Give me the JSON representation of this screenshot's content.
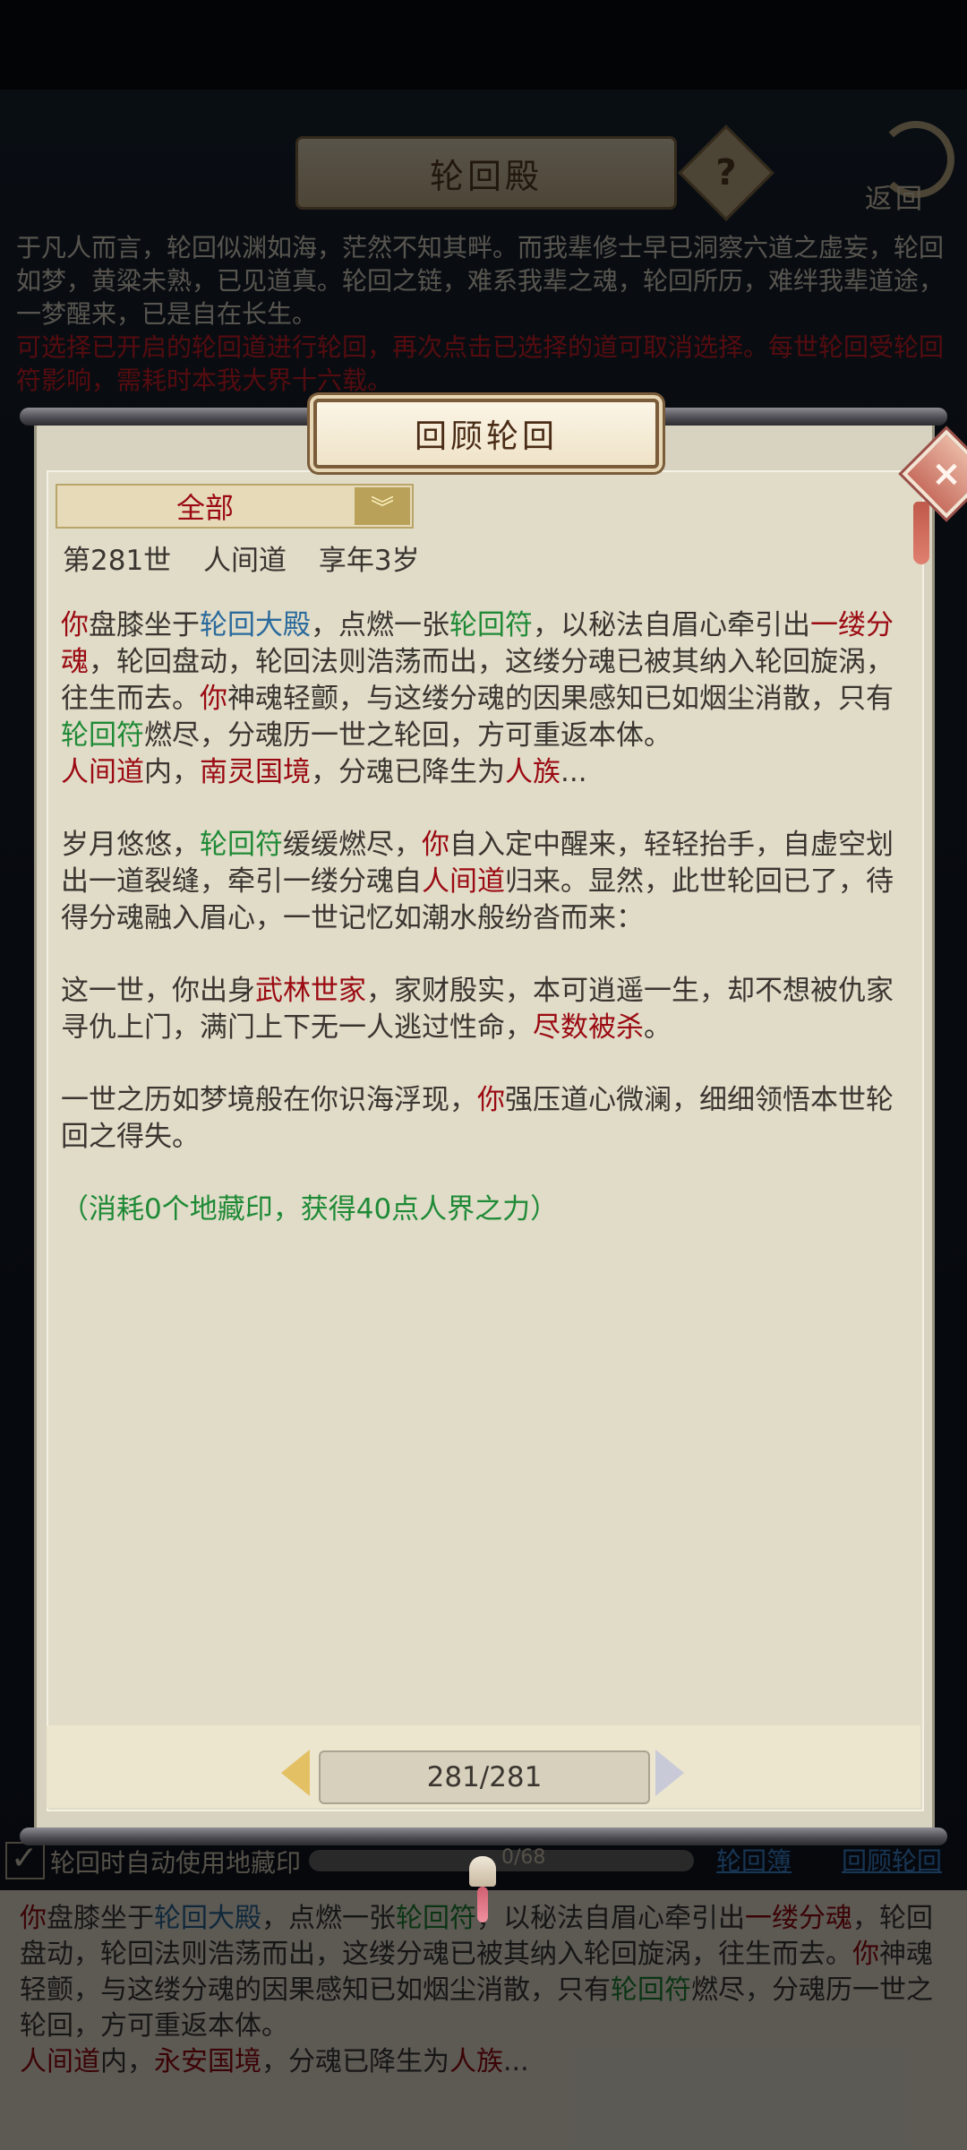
{
  "background": {
    "title": "轮回殿",
    "help_icon": "?",
    "back_label": "返回",
    "intro_text": "于凡人而言，轮回似渊如海，茫然不知其畔。而我辈修士早已洞察六道之虚妄，轮回如梦，黄粱未熟，已见道真。轮回之链，难系我辈之魂，轮回所历，难绊我辈道途，一梦醒来，已是自在长生。",
    "intro_warning": "可选择已开启的轮回道进行轮回，再次点击已选择的道可取消选择。每世轮回受轮回符影响，需耗时本我大界十六载。",
    "auto_use_label": "轮回时自动使用地藏印",
    "progress_text": "0/68",
    "link_book": "轮回簿",
    "link_review": "回顾轮回",
    "log": {
      "p1_you": "你",
      "p1_a": "盘膝坐于",
      "p1_hall": "轮回大殿",
      "p1_b": "，点燃一张",
      "p1_talisman": "轮回符",
      "p1_c": "，以秘法自眉心牵引出",
      "p1_soul": "一缕分魂",
      "p1_d": "，轮回盘动，轮回法则浩荡而出，这缕分魂已被其纳入轮回旋涡，往生而去。",
      "p1_you2": "你",
      "p1_e": "神魂轻颤，与这缕分魂的因果感知已如烟尘消散，只有",
      "p1_talisman2": "轮回符",
      "p1_f": "燃尽，分魂历一世之轮回，方可重返本体。",
      "p2_path": "人间道",
      "p2_a": "内，",
      "p2_realm": "永安国境",
      "p2_b": "，分魂已降生为",
      "p2_race": "人族",
      "p2_c": "..."
    }
  },
  "modal": {
    "title": "回顾轮回",
    "close_icon": "×",
    "filter": {
      "selected": "全部",
      "arrow_icon": "chevron-down-icon"
    },
    "record_header": {
      "life": "第281世",
      "path": "人间道",
      "age": "享年3岁"
    },
    "story": {
      "p1_you": "你",
      "p1_a": "盘膝坐于",
      "p1_hall": "轮回大殿",
      "p1_b": "，点燃一张",
      "p1_talisman": "轮回符",
      "p1_c": "，以秘法自眉心牵引出",
      "p1_soul": "一缕分魂",
      "p1_d": "，轮回盘动，轮回法则浩荡而出，这缕分魂已被其纳入轮回旋涡，往生而去。",
      "p1_you2": "你",
      "p1_e": "神魂轻颤，与这缕分魂的因果感知已如烟尘消散，只有",
      "p1_talisman2": "轮回符",
      "p1_f": "燃尽，分魂历一世之轮回，方可重返本体。",
      "p2_path": "人间道",
      "p2_a": "内，",
      "p2_realm": "南灵国境",
      "p2_b": "，分魂已降生为",
      "p2_race": "人族",
      "p2_c": "...",
      "p3_a": "岁月悠悠，",
      "p3_talisman": "轮回符",
      "p3_b": "缓缓燃尽，",
      "p3_you": "你",
      "p3_c": "自入定中醒来，轻轻抬手，自虚空划出一道裂缝，牵引一缕分魂自",
      "p3_path": "人间道",
      "p3_d": "归来。显然，此世轮回已了，待得分魂融入眉心，一世记忆如潮水般纷沓而来：",
      "p4_a": "这一世，你出身",
      "p4_family": "武林世家",
      "p4_b": "，家财殷实，本可逍遥一生，却不想被仇家寻仇上门，满门上下无一人逃过性命，",
      "p4_fate": "尽数被杀",
      "p4_c": "。",
      "p5_a": "一世之历如梦境般在你识海浮现，",
      "p5_you": "你",
      "p5_b": "强压道心微澜，细细领悟本世轮回之得失。",
      "p6": "（消耗0个地藏印，获得40点人界之力）"
    },
    "pager": {
      "current": "281/281"
    }
  },
  "colors": {
    "highlight_red": "#9b0a12",
    "highlight_green": "#1f8a36",
    "highlight_blue": "#2a6a9c",
    "paper": "#e0dcc8"
  }
}
